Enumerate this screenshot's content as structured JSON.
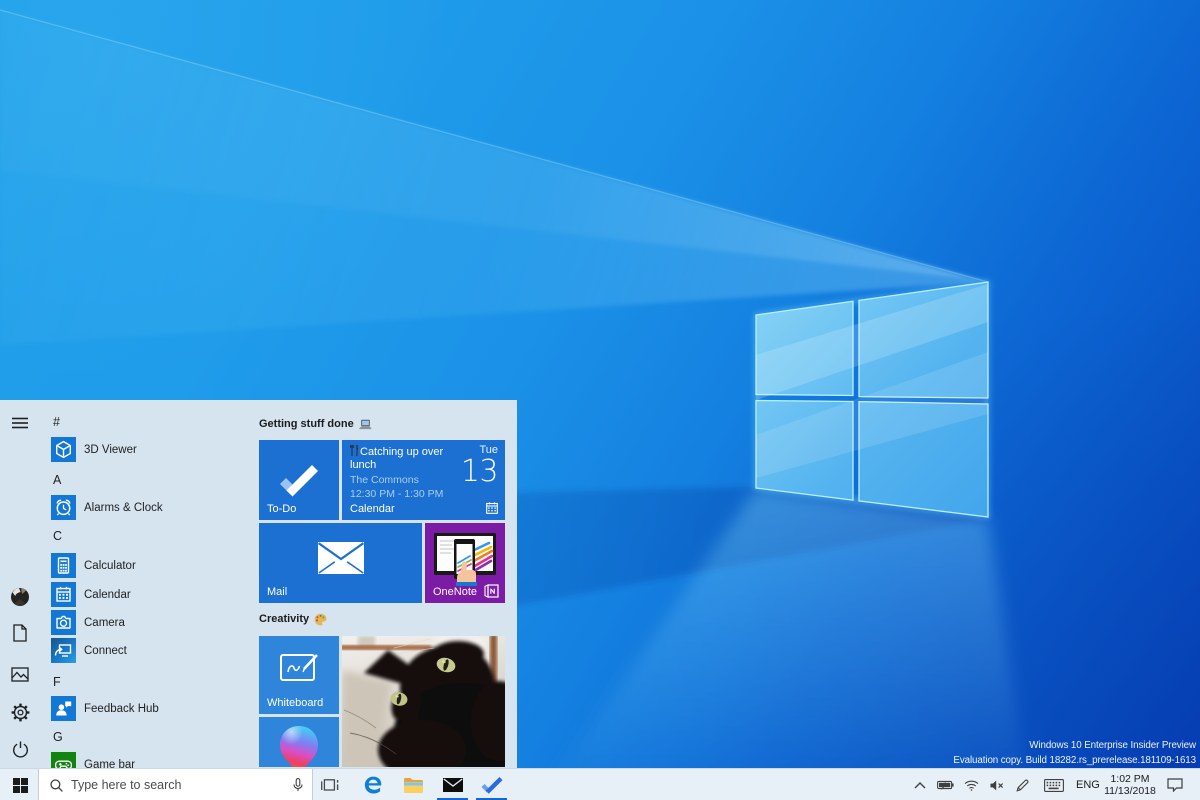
{
  "desktop": {
    "watermark": {
      "line1": "Windows 10 Enterprise Insider Preview",
      "line2": "Evaluation copy. Build 18282.rs_prerelease.181109-1613"
    }
  },
  "start_menu": {
    "rail": {
      "items": [
        "menu",
        "user-avatar",
        "documents",
        "pictures",
        "settings",
        "power"
      ]
    },
    "app_list": {
      "sections": [
        {
          "header": "#",
          "items": [
            {
              "label": "3D Viewer",
              "icon": "3d-viewer-icon"
            }
          ]
        },
        {
          "header": "A",
          "items": [
            {
              "label": "Alarms & Clock",
              "icon": "alarms-clock-icon"
            }
          ]
        },
        {
          "header": "C",
          "items": [
            {
              "label": "Calculator",
              "icon": "calculator-icon"
            },
            {
              "label": "Calendar",
              "icon": "calendar-icon"
            },
            {
              "label": "Camera",
              "icon": "camera-icon"
            },
            {
              "label": "Connect",
              "icon": "connect-icon"
            }
          ]
        },
        {
          "header": "F",
          "items": [
            {
              "label": "Feedback Hub",
              "icon": "feedback-hub-icon"
            }
          ]
        },
        {
          "header": "G",
          "items": [
            {
              "label": "Game bar",
              "icon": "game-bar-icon"
            }
          ]
        }
      ]
    },
    "tile_groups": [
      {
        "title": "Getting stuff done",
        "emoji": "laptop"
      },
      {
        "title": "Creativity",
        "emoji": "artist-palette"
      }
    ],
    "tiles": {
      "todo": {
        "label": "To-Do",
        "app": "Microsoft To-Do"
      },
      "calendar": {
        "label": "Calendar",
        "event_title": "Catching up over lunch",
        "event_location": "The Commons",
        "event_time": "12:30 PM - 1:30 PM",
        "weekday": "Tue",
        "day": "13"
      },
      "mail": {
        "label": "Mail"
      },
      "onenote": {
        "label": "OneNote"
      },
      "whiteboard": {
        "label": "Whiteboard"
      },
      "photos": {
        "label": ""
      },
      "paint3d": {
        "label": ""
      }
    }
  },
  "taskbar": {
    "search_placeholder": "Type here to search",
    "buttons": [
      "start",
      "task-view",
      "edge",
      "file-explorer",
      "mail",
      "todo"
    ],
    "running_apps": [
      "mail",
      "todo"
    ],
    "tray": {
      "icons": [
        "chevron-up",
        "battery",
        "wifi",
        "volume-muted",
        "pen",
        "touch-keyboard"
      ],
      "language": "ENG",
      "time": "1:02 PM",
      "date": "11/13/2018",
      "action_center": "notifications"
    }
  },
  "colors": {
    "accent_tile_blue": "#1c70d2",
    "tile_light_blue": "#2e85da",
    "onenote_purple": "#7c1ba5",
    "menu_background": "#d5e4ef",
    "taskbar_background": "#e7eff7",
    "wallpaper_deep_blue": "#0a52c4",
    "wallpaper_light_blue": "#3db2f0"
  }
}
